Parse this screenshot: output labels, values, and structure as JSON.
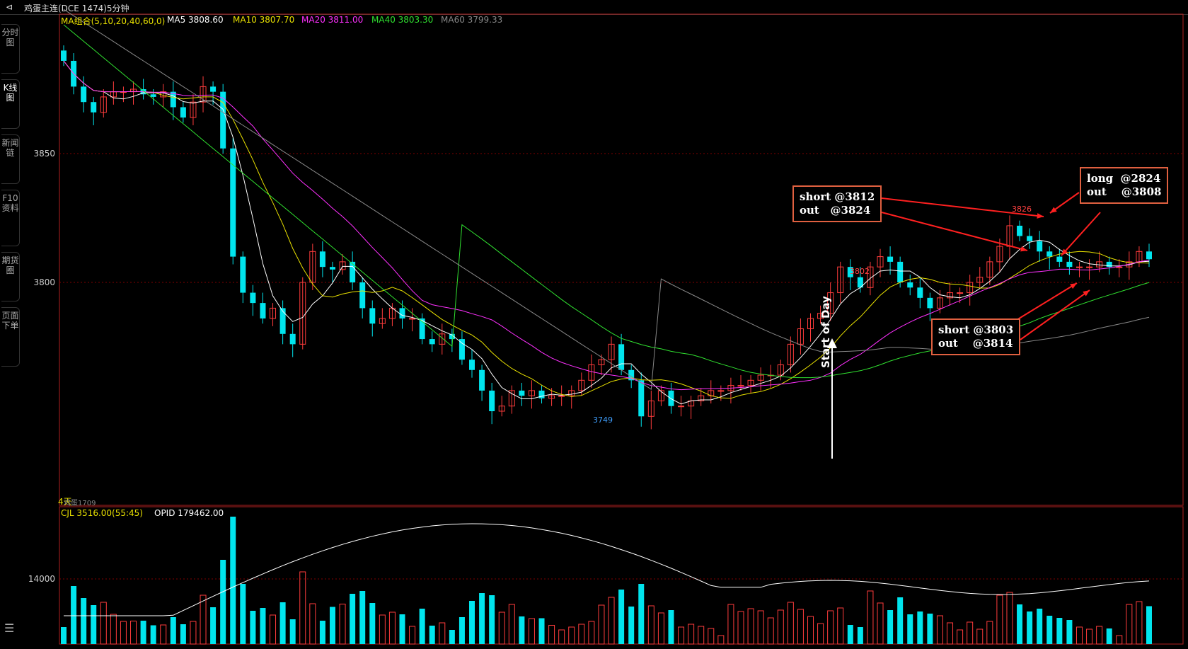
{
  "window": {
    "title": "鸡蛋主连(DCE 1474)5分钟"
  },
  "side_tabs": [
    {
      "label": "分时图"
    },
    {
      "label": "K线图"
    },
    {
      "label": "新闻链"
    },
    {
      "label": "F10资料"
    },
    {
      "label": "期货圈"
    },
    {
      "label": "页面下单"
    }
  ],
  "legend": {
    "ma_group": "MA组合(5,10,20,40,60,0)",
    "ma5": "MA5 3808.60",
    "ma10": "MA10 3807.70",
    "ma20": "MA20 3811.00",
    "ma40": "MA40 3803.30",
    "ma60": "MA60 3799.33",
    "bottom_left": "4天",
    "bottom_name": "鸡蛋1709",
    "vol": "CJL  3516.00(55:45)",
    "opi": "OPID   179462.00"
  },
  "colors": {
    "up": "#ff3c3c",
    "down": "#00e5ee",
    "ma5": "#ffffff",
    "ma10": "#e8e000",
    "ma20": "#ff30ff",
    "ma40": "#30e030",
    "ma60": "#888888"
  },
  "annotations": {
    "note1": "short @3812\nout   @3824",
    "note2": "long  @2824\nout    @3808",
    "note3": "short @3803\nout    @3814",
    "start_of_day": "Start of Day",
    "high_label": "3826",
    "low_label": "3749",
    "mid_label": "3802"
  },
  "chart_data": [
    {
      "type": "candlestick",
      "title": "鸡蛋主连(DCE 1474)5分钟",
      "y_ticks": [
        3850,
        3800
      ],
      "ylim": [
        3730,
        3900
      ],
      "grid": true,
      "ohlc_close_sequence": [
        3886,
        3876,
        3870,
        3866,
        3872,
        3874,
        3874,
        3875,
        3873,
        3872,
        3874,
        3868,
        3864,
        3870,
        3876,
        3874,
        3852,
        3810,
        3796,
        3792,
        3786,
        3790,
        3780,
        3776,
        3800,
        3812,
        3806,
        3805,
        3808,
        3800,
        3790,
        3784,
        3786,
        3790,
        3786,
        3786,
        3778,
        3776,
        3780,
        3778,
        3770,
        3766,
        3758,
        3750,
        3752,
        3758,
        3756,
        3758,
        3755,
        3756,
        3756,
        3758,
        3762,
        3768,
        3770,
        3776,
        3766,
        3762,
        3748,
        3754,
        3758,
        3752,
        3752,
        3754,
        3756,
        3758,
        3758,
        3760,
        3760,
        3762,
        3764,
        3764,
        3768,
        3776,
        3782,
        3786,
        3788,
        3796,
        3806,
        3802,
        3798,
        3806,
        3810,
        3808,
        3800,
        3798,
        3794,
        3790,
        3794,
        3796,
        3796,
        3800,
        3802,
        3808,
        3814,
        3822,
        3818,
        3816,
        3812,
        3810,
        3808,
        3806,
        3806,
        3806,
        3808,
        3806,
        3806,
        3808,
        3812,
        3809
      ]
    },
    {
      "type": "bar",
      "title": "CJL",
      "y_ticks": [
        14000
      ],
      "series": [
        {
          "name": "CJL"
        },
        {
          "name": "OPID"
        }
      ]
    }
  ]
}
